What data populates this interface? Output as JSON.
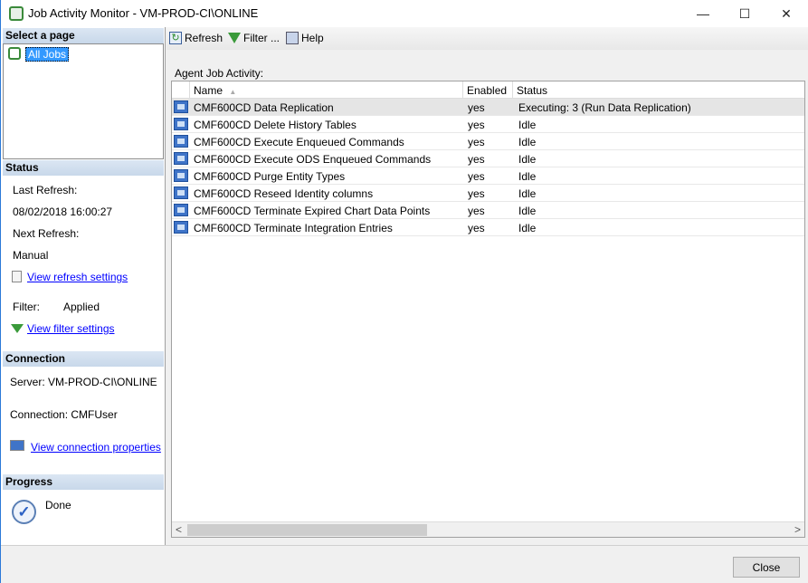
{
  "window": {
    "title": "Job Activity Monitor - VM-PROD-CI\\ONLINE",
    "minimize": "—",
    "maximize": "☐",
    "close": "✕"
  },
  "left": {
    "select_page": "Select a page",
    "pages": [
      "All Jobs"
    ],
    "status_header": "Status",
    "last_refresh_label": "Last Refresh:",
    "last_refresh_value": "08/02/2018 16:00:27",
    "next_refresh_label": "Next Refresh:",
    "next_refresh_value": "Manual",
    "view_refresh": "View refresh settings",
    "filter_label": "Filter:",
    "filter_value": "Applied",
    "view_filter": "View filter settings",
    "connection_header": "Connection",
    "server": "Server: VM-PROD-CI\\ONLINE",
    "connection": "Connection: CMFUser",
    "view_connection": "View connection properties",
    "progress_header": "Progress",
    "progress_status": "Done"
  },
  "toolbar": {
    "refresh": "Refresh",
    "filter": "Filter ...",
    "help": "Help"
  },
  "grid": {
    "caption": "Agent Job Activity:",
    "columns": [
      "Name",
      "Enabled",
      "Status"
    ],
    "sort_indicator": "▲",
    "rows": [
      {
        "name": "CMF600CD Data Replication",
        "enabled": "yes",
        "status": "Executing: 3 (Run Data Replication)"
      },
      {
        "name": "CMF600CD Delete History Tables",
        "enabled": "yes",
        "status": "Idle"
      },
      {
        "name": "CMF600CD Execute Enqueued Commands",
        "enabled": "yes",
        "status": "Idle"
      },
      {
        "name": "CMF600CD Execute ODS Enqueued Commands",
        "enabled": "yes",
        "status": "Idle"
      },
      {
        "name": "CMF600CD Purge Entity Types",
        "enabled": "yes",
        "status": "Idle"
      },
      {
        "name": "CMF600CD Reseed Identity columns",
        "enabled": "yes",
        "status": "Idle"
      },
      {
        "name": "CMF600CD Terminate Expired Chart Data Points",
        "enabled": "yes",
        "status": "Idle"
      },
      {
        "name": "CMF600CD Terminate Integration Entries",
        "enabled": "yes",
        "status": "Idle"
      }
    ],
    "scroll_left": "<",
    "scroll_right": ">"
  },
  "footer": {
    "close": "Close"
  }
}
